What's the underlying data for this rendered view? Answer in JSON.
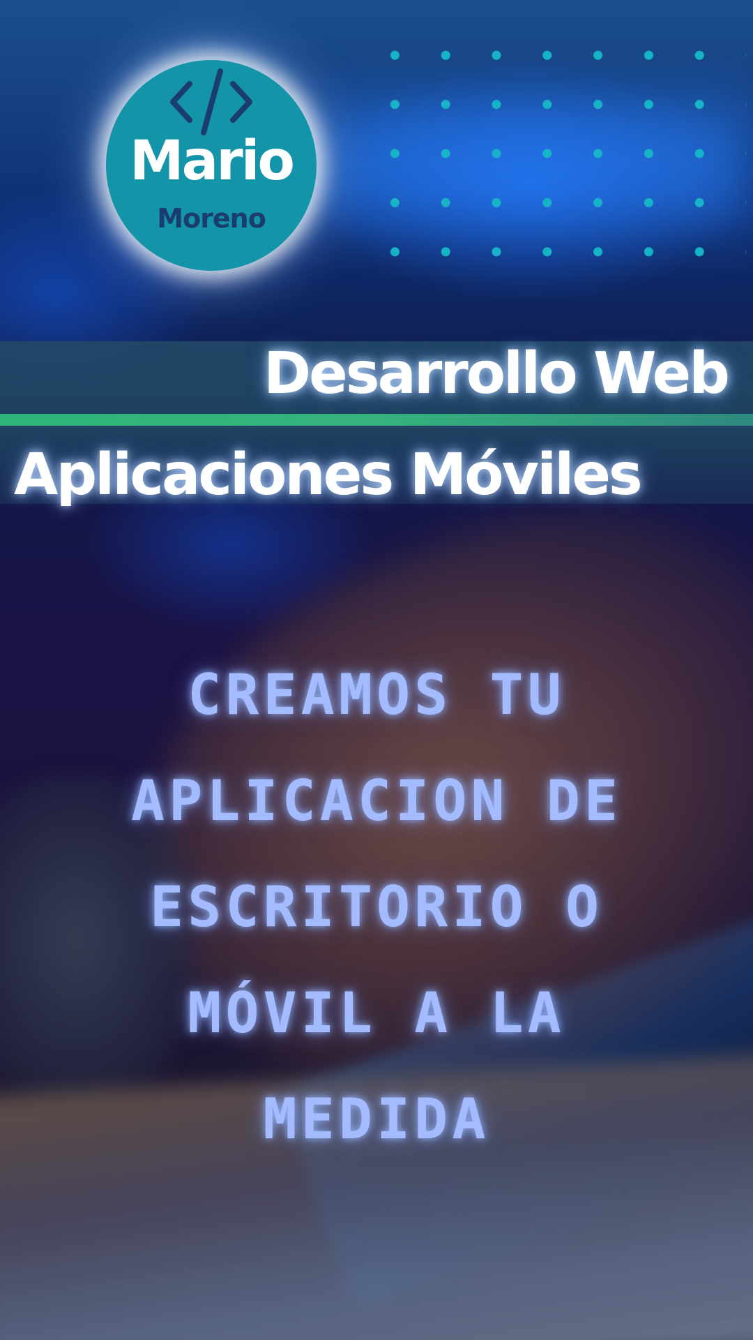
{
  "logo": {
    "icon": "code-brackets-icon",
    "name": "Mario",
    "surname": "Moreno",
    "badge_color": "#1394a8",
    "surname_color": "#1b3c70"
  },
  "services": {
    "web": "Desarrollo Web",
    "mobile": "Aplicaciones Móviles",
    "band_color": "#224a66",
    "accent_color": "#2fb47a"
  },
  "headline": {
    "lines": [
      "CREAMOS TU",
      "APLICACION DE",
      "ESCRITORIO O",
      "MÓVIL A LA",
      "MEDIDA"
    ],
    "color": "#a4bbff"
  },
  "decor": {
    "dot_grid_color": "#17b3c6"
  }
}
